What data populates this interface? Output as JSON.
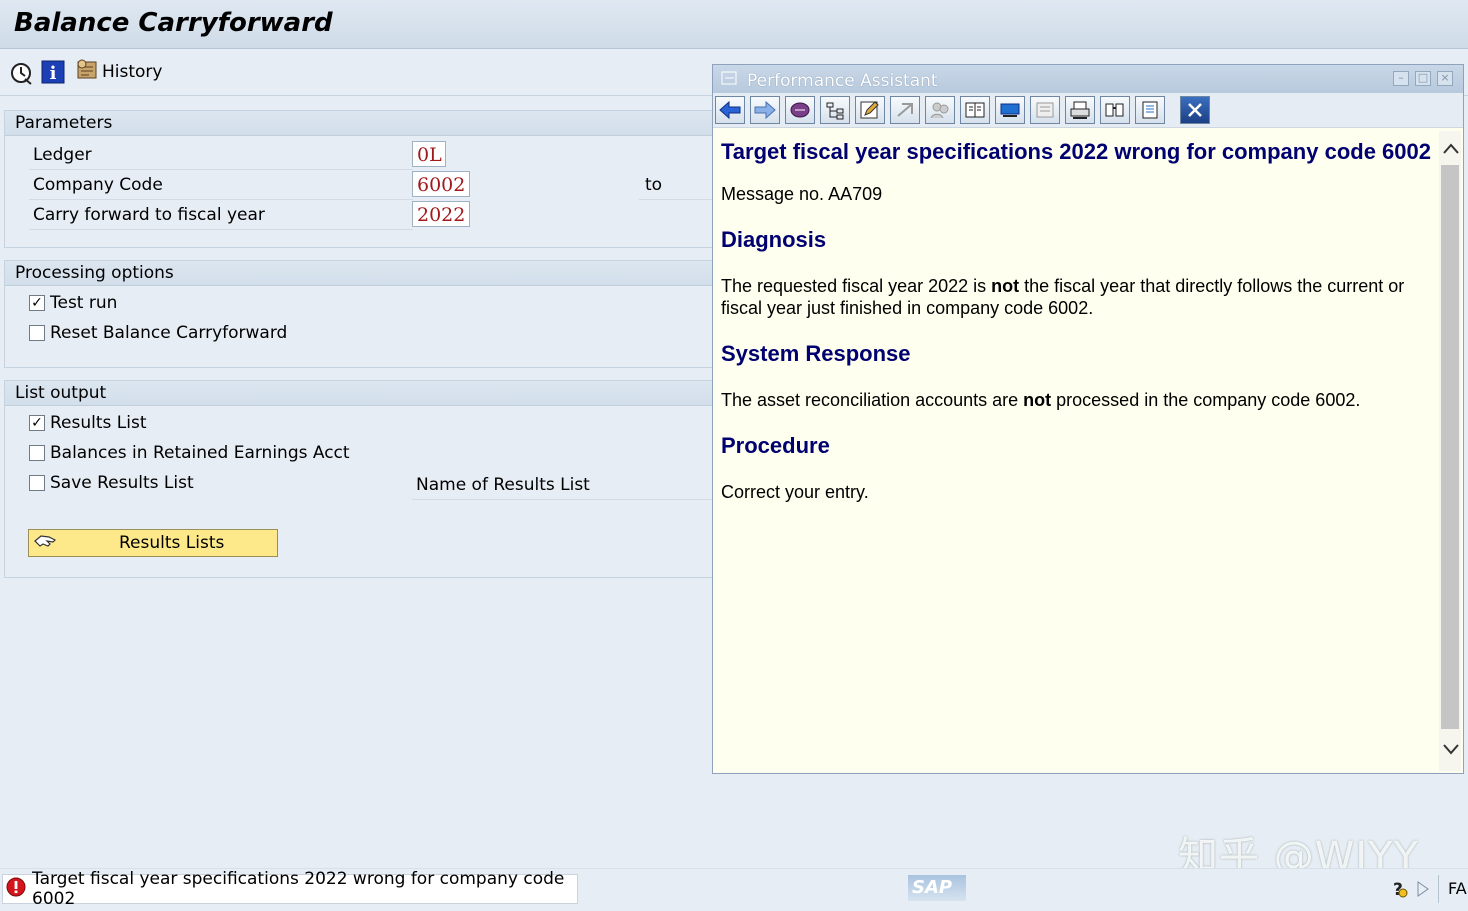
{
  "window": {
    "title": "Balance Carryforward"
  },
  "toolbar": {
    "history_label": "History"
  },
  "parameters": {
    "title": "Parameters",
    "ledger_label": "Ledger",
    "ledger_value": "0L",
    "company_code_label": "Company Code",
    "company_code_value": "6002",
    "to_label": "to",
    "fiscal_year_label": "Carry forward to fiscal year",
    "fiscal_year_value": "2022"
  },
  "processing": {
    "title": "Processing options",
    "test_run_label": "Test run",
    "test_run_checked": true,
    "reset_label": "Reset Balance Carryforward",
    "reset_checked": false
  },
  "list_output": {
    "title": "List output",
    "results_list_label": "Results List",
    "results_list_checked": true,
    "balances_label": "Balances in Retained Earnings Acct",
    "balances_checked": false,
    "save_label": "Save Results List",
    "save_checked": false,
    "name_label": "Name of Results List",
    "results_button_label": "Results Lists"
  },
  "assistant": {
    "title": "Performance Assistant",
    "heading": "Target fiscal year specifications 2022 wrong for company code 6002",
    "message_no": "Message no. AA709",
    "diagnosis_title": "Diagnosis",
    "diagnosis_pre": "The requested fiscal year 2022 is ",
    "diagnosis_bold": "not",
    "diagnosis_post": " the fiscal year that directly follows the current or fiscal year just finished in company code 6002.",
    "response_title": "System Response",
    "response_pre": "The asset reconciliation accounts are ",
    "response_bold": "not",
    "response_post": " processed in the company code 6002.",
    "procedure_title": "Procedure",
    "procedure_text": "Correct your entry."
  },
  "status": {
    "message": "Target fiscal year specifications 2022 wrong for company code 6002",
    "logo": "SAP",
    "right_text": "FA"
  },
  "watermark": "知乎 @WJYY",
  "colors": {
    "field_text": "#a0191b",
    "heading_blue": "#000070",
    "button_yellow": "#fde98a",
    "error_red": "#d4161c"
  }
}
